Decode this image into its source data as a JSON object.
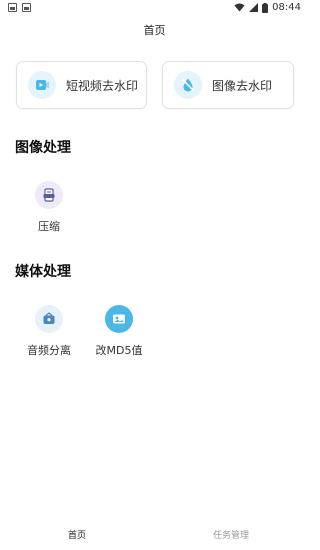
{
  "status_bar": {
    "time": "08:44"
  },
  "nav": {
    "title": "首页"
  },
  "cards": [
    {
      "label": "短视频去水印",
      "icon": "video-watermark-icon"
    },
    {
      "label": "图像去水印",
      "icon": "image-watermark-icon"
    }
  ],
  "sections": {
    "image": {
      "title": "图像处理",
      "tools": [
        {
          "label": "压缩",
          "icon": "compress-icon"
        }
      ]
    },
    "media": {
      "title": "媒体处理",
      "tools": [
        {
          "label": "音频分离",
          "icon": "audio-separate-icon"
        },
        {
          "label": "改MD5值",
          "icon": "md5-icon"
        }
      ]
    }
  },
  "tabs": [
    {
      "label": "首页",
      "active": true
    },
    {
      "label": "任务管理",
      "active": false
    }
  ],
  "colors": {
    "card_icon_bg": "#e4f4fb",
    "accent_blue": "#4bb7e6",
    "compress_bg": "#efeaf7",
    "audio_bg": "#e7f1fa",
    "md5_bg": "#4bb7e6",
    "tab_active": "#222222",
    "tab_inactive": "#9a9a9a"
  }
}
